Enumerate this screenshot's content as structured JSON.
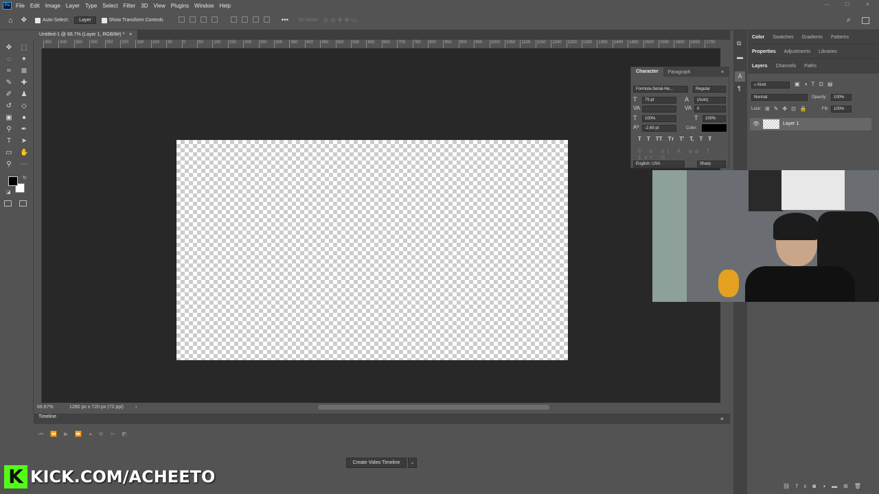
{
  "menu": {
    "app_icon": "Ps",
    "items": [
      "File",
      "Edit",
      "Image",
      "Layer",
      "Type",
      "Select",
      "Filter",
      "3D",
      "View",
      "Plugins",
      "Window",
      "Help"
    ]
  },
  "options": {
    "auto_select": "Auto-Select:",
    "layer_value": "Layer",
    "show_transform": "Show Transform Controls",
    "mode_3d": "3D Mode:"
  },
  "document": {
    "tab_title": "Untitled-1 @ 66.7% (Layer 1, RGB/8#) *",
    "close": "×"
  },
  "ruler": {
    "ticks": [
      "450",
      "400",
      "350",
      "300",
      "250",
      "200",
      "150",
      "100",
      "50",
      "0",
      "50",
      "100",
      "150",
      "200",
      "250",
      "300",
      "350",
      "400",
      "450",
      "500",
      "550",
      "600",
      "650",
      "700",
      "750",
      "800",
      "850",
      "900",
      "950",
      "1000",
      "1050",
      "1100",
      "1150",
      "1200",
      "1250",
      "1300",
      "1350",
      "1400",
      "1450",
      "1500",
      "1550",
      "1600",
      "1650",
      "1700",
      "1750"
    ]
  },
  "status": {
    "zoom": "66.67%",
    "dimensions": "1280 px x 720 px (72 ppi)"
  },
  "timeline": {
    "title": "Timeline",
    "create_button": "Create Video Timeline"
  },
  "character": {
    "tabs": [
      "Character",
      "Paragraph"
    ],
    "font_family": "Formula-Serial-He...",
    "font_style": "Regular",
    "size": "75 pt",
    "leading": "(Auto)",
    "tracking": "0",
    "vscale": "100%",
    "hscale": "100%",
    "baseline": "-2.69 pt",
    "color_label": "Color:",
    "language": "English: USA",
    "antialias": "Sharp",
    "styles": [
      "T",
      "T",
      "TT",
      "Tт",
      "T'",
      "T,",
      "T",
      "Ŧ"
    ],
    "color": "#000000"
  },
  "right": {
    "tabs1": [
      "Color",
      "Swatches",
      "Gradients",
      "Patterns"
    ],
    "tabs2": [
      "Properties",
      "Adjustments",
      "Libraries"
    ],
    "tabs3": [
      "Layers",
      "Channels",
      "Paths"
    ],
    "kind": "Kind",
    "blend": "Normal",
    "opacity_label": "Opacity:",
    "opacity": "100%",
    "lock_label": "Lock:",
    "fill_label": "Fill:",
    "fill": "100%",
    "layer_name": "Layer 1"
  },
  "overlay": {
    "kick_logo": "K",
    "kick_url": "KICK.COM/ACHEETO"
  }
}
